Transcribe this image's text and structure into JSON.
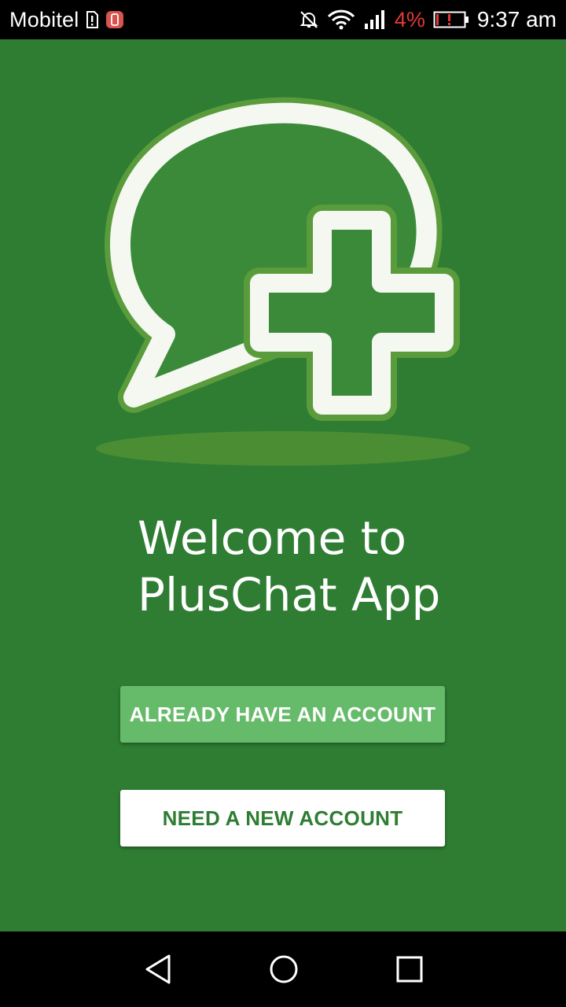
{
  "status_bar": {
    "carrier": "Mobitel",
    "battery_percent": "4%",
    "time": "9:37 am",
    "icons": [
      "sim-alert-icon",
      "app-notification-icon",
      "mute-icon",
      "wifi-icon",
      "signal-icon",
      "battery-low-icon"
    ]
  },
  "app": {
    "background_color": "#2e7d32",
    "logo_icon": "chat-bubble-plus-icon",
    "welcome_line1": "Welcome to",
    "welcome_line2": "PlusChat App",
    "login_button": "ALREADY HAVE AN ACCOUNT",
    "register_button": "NEED A NEW ACCOUNT",
    "accent_color": "#66bb6a"
  },
  "nav_bar": {
    "icons": [
      "back-icon",
      "home-icon",
      "recents-icon"
    ]
  }
}
